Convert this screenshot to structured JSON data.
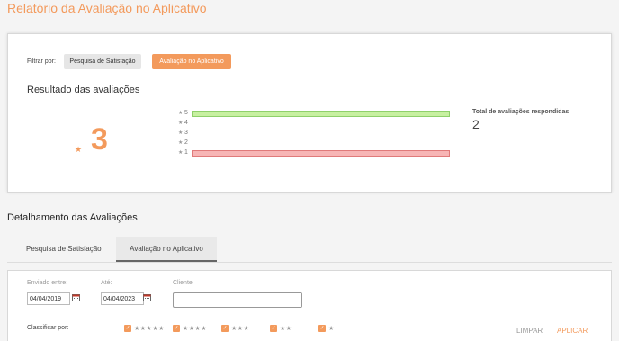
{
  "page": {
    "title": "Relatório da Avaliação no Aplicativo"
  },
  "filter": {
    "label": "Filtrar por:",
    "options": [
      "Pesquisa de Satisfação",
      "Avaliação no Aplicativo"
    ],
    "selected": "Avaliação no Aplicativo"
  },
  "result": {
    "title": "Resultado das avaliações",
    "star": "★",
    "average": "3",
    "total_label": "Total de avaliações respondidas",
    "total_value": "2"
  },
  "chart_data": {
    "type": "bar",
    "orientation": "horizontal",
    "categories": [
      "5",
      "4",
      "3",
      "2",
      "1"
    ],
    "values": [
      1,
      0,
      0,
      0,
      1
    ],
    "colors": {
      "5": "#c7f0a0",
      "1": "#f7b5b5"
    },
    "border_colors": {
      "5": "#8fd06a",
      "1": "#e07a7a"
    }
  },
  "details": {
    "title": "Detalhamento das Avaliações",
    "tabs": [
      "Pesquisa de Satisfação",
      "Avaliação no Aplicativo"
    ],
    "active_tab": "Avaliação no Aplicativo"
  },
  "form": {
    "sent_between_label": "Enviado entre:",
    "start_date": "04/04/2019",
    "until_label": "Até:",
    "end_date": "04/04/2023",
    "client_label": "Cliente",
    "client_value": "",
    "classify_label": "Classificar por:",
    "rating_options": [
      "★★★★★",
      "★★★★",
      "★★★",
      "★★",
      "★"
    ],
    "clear_label": "LIMPAR",
    "apply_label": "APLICAR"
  },
  "colors": {
    "accent": "#f39a5c"
  }
}
